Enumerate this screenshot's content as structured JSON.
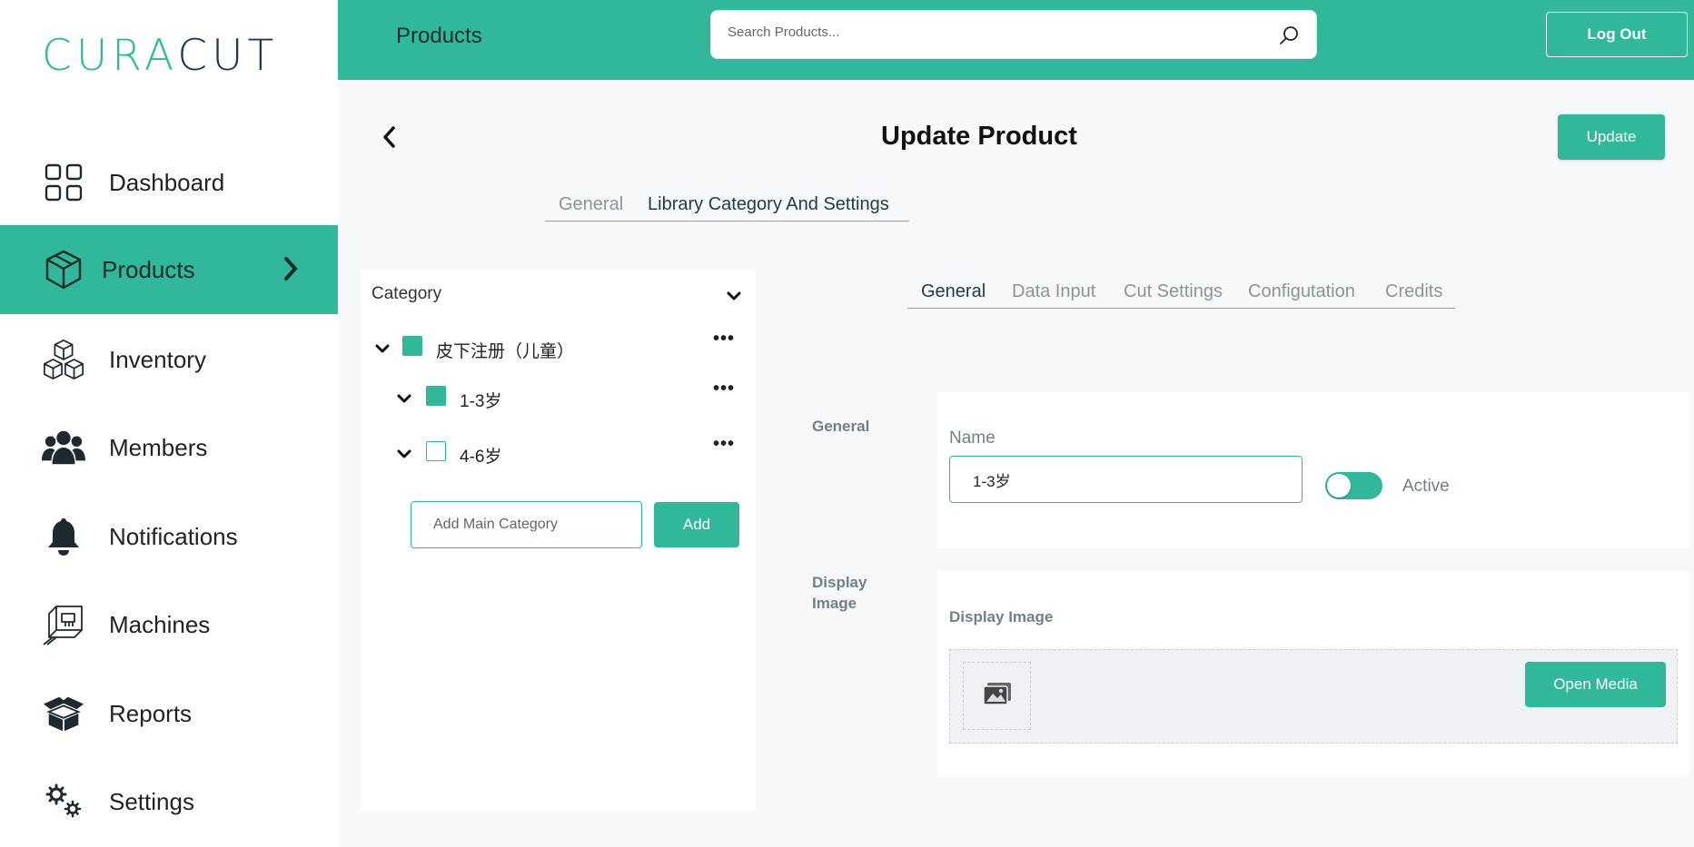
{
  "brand": {
    "logo_part1": "CURA",
    "logo_part2": "CUT"
  },
  "sidebar": {
    "items": [
      {
        "label": "Dashboard",
        "icon": "dashboard-icon"
      },
      {
        "label": "Products",
        "icon": "box-icon",
        "active": true
      },
      {
        "label": "Inventory",
        "icon": "cubes-icon"
      },
      {
        "label": "Members",
        "icon": "users-icon"
      },
      {
        "label": "Notifications",
        "icon": "bell-icon"
      },
      {
        "label": "Machines",
        "icon": "machine-icon"
      },
      {
        "label": "Reports",
        "icon": "open-box-icon"
      },
      {
        "label": "Settings",
        "icon": "gears-icon"
      }
    ]
  },
  "header": {
    "title": "Products",
    "search_placeholder": "Search Products...",
    "logout_label": "Log Out"
  },
  "page": {
    "title": "Update Product",
    "update_label": "Update",
    "tabs": [
      "General",
      "Library Category And Settings"
    ],
    "active_tab": "Library Category And Settings"
  },
  "category_panel": {
    "header": "Category",
    "items": [
      {
        "name": "皮下注册（儿童）",
        "checked": true,
        "level": 0
      },
      {
        "name": "1-3岁",
        "checked": true,
        "level": 1
      },
      {
        "name": "4-6岁",
        "checked": false,
        "level": 1
      }
    ],
    "add_placeholder": "Add Main Category",
    "add_label": "Add"
  },
  "settings_tabs": [
    "General",
    "Data Input",
    "Cut Settings",
    "Configutation",
    "Credits"
  ],
  "settings_active_tab": "General",
  "general_section": {
    "label": "General",
    "name_label": "Name",
    "name_value": "1-3岁",
    "active_label": "Active",
    "active": true
  },
  "display_image_section": {
    "label": "Display Image",
    "title": "Display Image",
    "open_media_label": "Open Media"
  },
  "colors": {
    "accent": "#31b89a",
    "brand_dark": "#1f3a4d"
  }
}
